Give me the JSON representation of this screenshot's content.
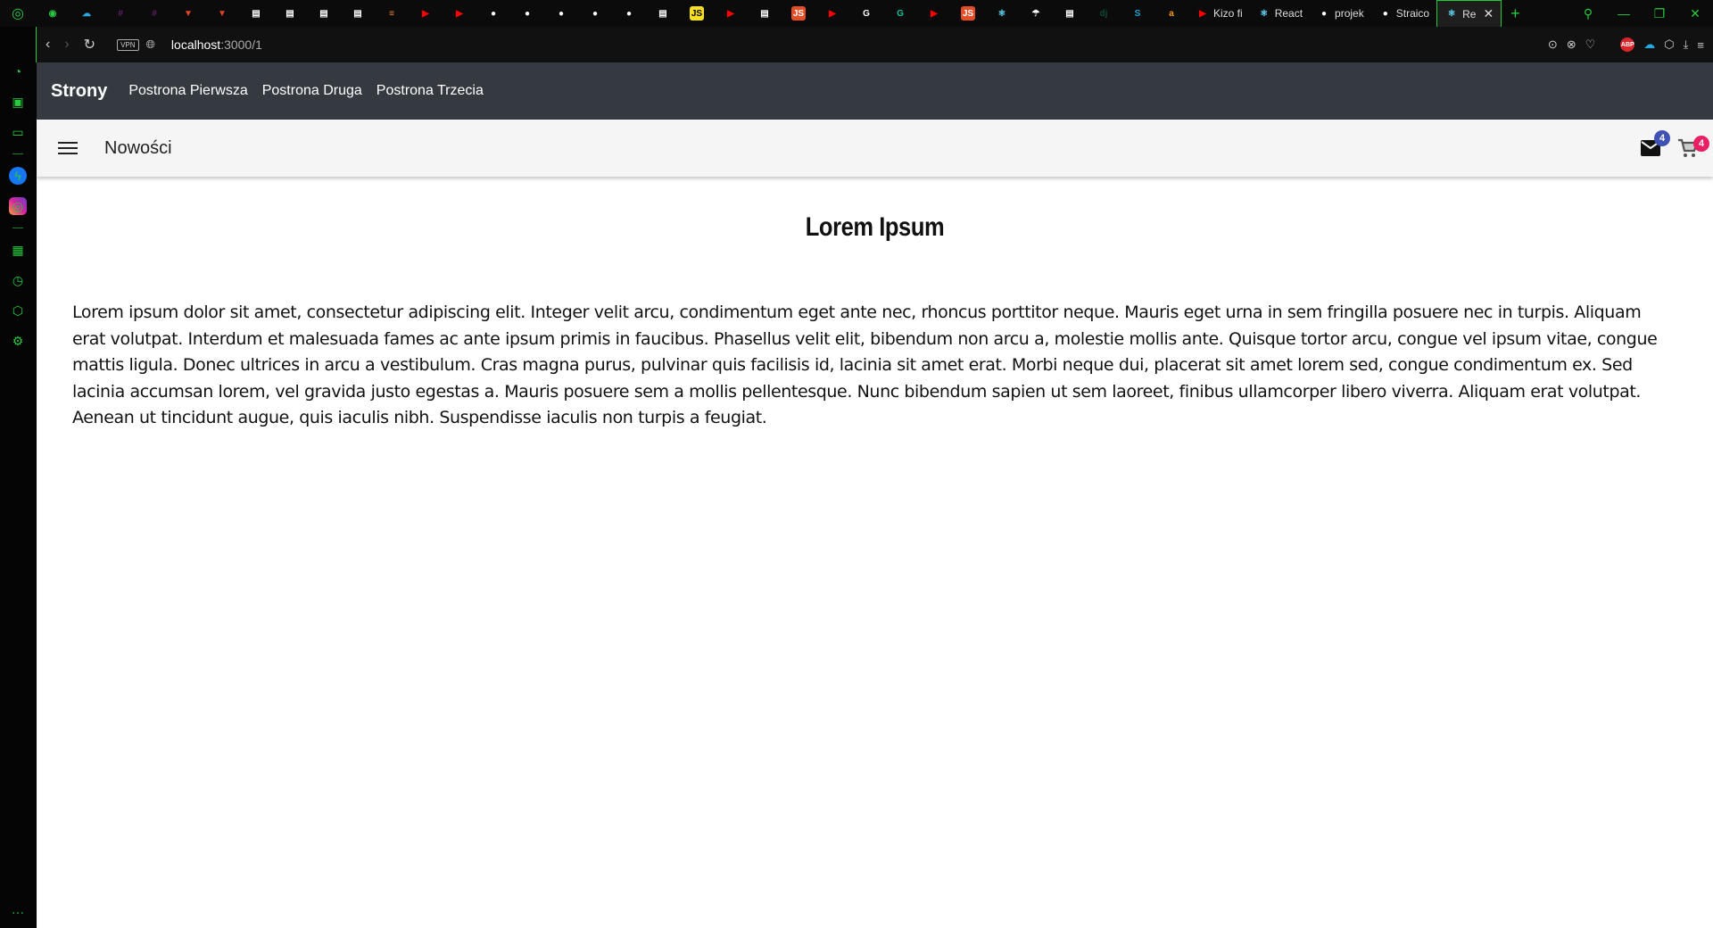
{
  "browser": {
    "tabs": [
      {
        "icon": "gamepad-icon",
        "color": "#27c93f",
        "glyph": "◉"
      },
      {
        "icon": "cloud-icon",
        "color": "#2aa7e0",
        "glyph": "☁"
      },
      {
        "icon": "slack-icon",
        "color": "#611f69",
        "glyph": "#"
      },
      {
        "icon": "slack-icon",
        "color": "#611f69",
        "glyph": "#"
      },
      {
        "icon": "gitlab-icon",
        "color": "#e24329",
        "glyph": "▼"
      },
      {
        "icon": "gitlab-icon",
        "color": "#e24329",
        "glyph": "▼"
      },
      {
        "icon": "document-icon",
        "color": "#ffffff",
        "glyph": "▤"
      },
      {
        "icon": "document-icon",
        "color": "#ffffff",
        "glyph": "▤"
      },
      {
        "icon": "document-icon",
        "color": "#ffffff",
        "glyph": "▤"
      },
      {
        "icon": "document-icon",
        "color": "#ffffff",
        "glyph": "▤"
      },
      {
        "icon": "stackoverflow-icon",
        "color": "#f48024",
        "glyph": "≡"
      },
      {
        "icon": "youtube-icon",
        "color": "#ff0000",
        "glyph": "▶"
      },
      {
        "icon": "youtube-icon",
        "color": "#ff0000",
        "glyph": "▶"
      },
      {
        "icon": "github-icon",
        "color": "#ffffff",
        "glyph": "●"
      },
      {
        "icon": "github-icon",
        "color": "#ffffff",
        "glyph": "●"
      },
      {
        "icon": "github-icon",
        "color": "#ffffff",
        "glyph": "●"
      },
      {
        "icon": "github-icon",
        "color": "#ffffff",
        "glyph": "●"
      },
      {
        "icon": "github-icon",
        "color": "#ffffff",
        "glyph": "●"
      },
      {
        "icon": "document-icon",
        "color": "#ffffff",
        "glyph": "▤"
      },
      {
        "icon": "javascript-icon",
        "color": "#f7df1e",
        "glyph": "JS"
      },
      {
        "icon": "youtube-icon",
        "color": "#ff0000",
        "glyph": "▶"
      },
      {
        "icon": "document-icon",
        "color": "#ffffff",
        "glyph": "▤"
      },
      {
        "icon": "javascript-icon",
        "color": "#e44d26",
        "glyph": "JS"
      },
      {
        "icon": "youtube-icon",
        "color": "#ff0000",
        "glyph": "▶"
      },
      {
        "icon": "google-icon",
        "color": "#ffffff",
        "glyph": "G"
      },
      {
        "icon": "grammarly-icon",
        "color": "#15c39a",
        "glyph": "G"
      },
      {
        "icon": "youtube-icon",
        "color": "#ff0000",
        "glyph": "▶"
      },
      {
        "icon": "javascript-icon",
        "color": "#e44d26",
        "glyph": "JS"
      },
      {
        "icon": "react-icon",
        "color": "#61dafb",
        "glyph": "⚛"
      },
      {
        "icon": "dev-icon",
        "color": "#ffffff",
        "glyph": "☂"
      },
      {
        "icon": "document-icon",
        "color": "#ffffff",
        "glyph": "▤"
      },
      {
        "icon": "django-icon",
        "color": "#0c4b33",
        "glyph": "dj"
      },
      {
        "icon": "s-icon",
        "color": "#1fa2d6",
        "glyph": "S"
      },
      {
        "icon": "amazon-icon",
        "color": "#ff9900",
        "glyph": "a"
      },
      {
        "icon": "youtube-icon",
        "color": "#ff0000",
        "glyph": "▶",
        "label": "Kizo fi"
      },
      {
        "icon": "react-icon",
        "color": "#61dafb",
        "glyph": "⚛",
        "label": "React"
      },
      {
        "icon": "github-icon",
        "color": "#ffffff",
        "glyph": "●",
        "label": "projek"
      },
      {
        "icon": "github-icon",
        "color": "#ffffff",
        "glyph": "●",
        "label": "Straico"
      }
    ],
    "active_tab": {
      "icon": "react-icon",
      "glyph": "⚛",
      "label": "Re"
    },
    "url_host": "localhost",
    "url_path": ":3000/1",
    "vpn_label": "VPN",
    "abp_label": "ABP"
  },
  "topnav": {
    "brand": "Strony",
    "links": [
      "Postrona Pierwsza",
      "Postrona Druga",
      "Postrona Trzecia"
    ]
  },
  "appbar": {
    "title": "Nowości",
    "mail_badge": "4",
    "cart_badge": "4"
  },
  "content": {
    "title": "Lorem Ipsum",
    "paragraph": "Lorem ipsum dolor sit amet, consectetur adipiscing elit. Integer velit arcu, condimentum eget ante nec, rhoncus porttitor neque. Mauris eget urna in sem fringilla posuere nec in turpis. Aliquam erat volutpat. Interdum et malesuada fames ac ante ipsum primis in faucibus. Phasellus velit elit, bibendum non arcu a, molestie mollis ante. Quisque tortor arcu, congue vel ipsum vitae, congue mattis ligula. Donec ultrices in arcu a vestibulum. Cras magna purus, pulvinar quis facilisis id, lacinia sit amet erat. Morbi neque dui, placerat sit amet lorem sed, congue condimentum ex. Sed lacinia accumsan lorem, vel gravida justo egestas a. Mauris posuere sem a mollis pellentesque. Nunc bibendum sapien ut sem laoreet, finibus ullamcorper libero viverra. Aliquam erat volutpat. Aenean ut tincidunt augue, quis iaculis nibh. Suspendisse iaculis non turpis a feugiat."
  }
}
